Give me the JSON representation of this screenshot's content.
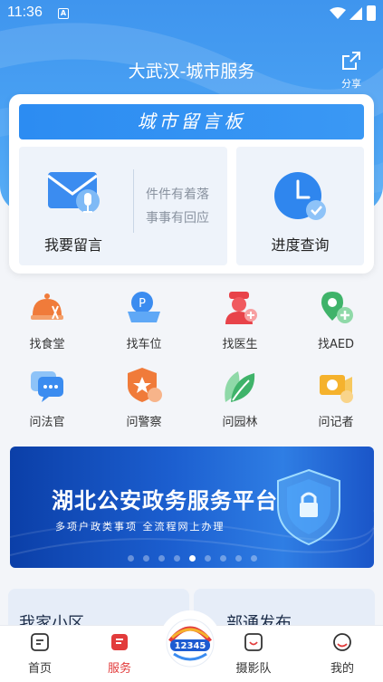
{
  "status_bar": {
    "time": "11:36",
    "notification_icon": "A"
  },
  "header": {
    "title": "大武汉-城市服务",
    "share_label": "分享",
    "share_icon": "share-icon"
  },
  "message_card": {
    "banner_text": "城市留言板",
    "leave_message": {
      "label": "我要留言",
      "slogan_line1": "件件有着落",
      "slogan_line2": "事事有回应",
      "icon": "mail-icon"
    },
    "progress": {
      "label": "进度查询",
      "icon": "clock-icon"
    }
  },
  "services": [
    {
      "label": "找食堂",
      "icon": "canteen-icon"
    },
    {
      "label": "找车位",
      "icon": "parking-icon"
    },
    {
      "label": "找医生",
      "icon": "doctor-icon"
    },
    {
      "label": "找AED",
      "icon": "aed-icon"
    },
    {
      "label": "问法官",
      "icon": "chat-icon"
    },
    {
      "label": "问警察",
      "icon": "police-badge-icon"
    },
    {
      "label": "问园林",
      "icon": "leaf-icon"
    },
    {
      "label": "问记者",
      "icon": "camera-icon"
    }
  ],
  "promo_banner": {
    "title": "湖北公安政务服务平台",
    "subtitle": "多项户政类事项  全流程网上办理",
    "slide_count": 9,
    "active_slide": 5
  },
  "bottom_cards": [
    {
      "label": "我家小区"
    },
    {
      "label": "部通发布"
    }
  ],
  "tab_bar": {
    "items": [
      {
        "label": "首页",
        "icon": "home-icon",
        "active": false
      },
      {
        "label": "服务",
        "icon": "service-icon",
        "active": true
      },
      {
        "label": "12345",
        "icon": "hotline-12345-icon",
        "active": false
      },
      {
        "label": "摄影队",
        "icon": "photo-team-icon",
        "active": false
      },
      {
        "label": "我的",
        "icon": "profile-icon",
        "active": false
      }
    ]
  },
  "colors": {
    "primary": "#3f95ee",
    "active_tab": "#e23b3b",
    "banner": "#1c5fd0"
  }
}
